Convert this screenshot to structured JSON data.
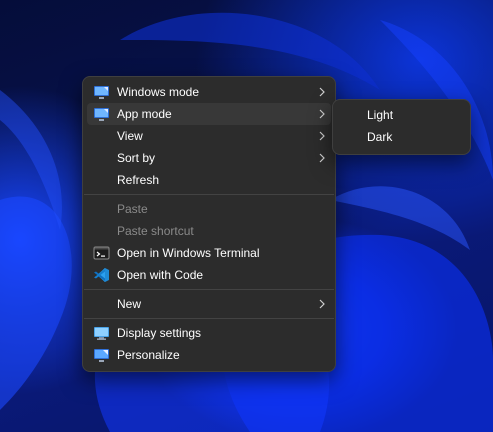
{
  "context_menu": {
    "items": [
      {
        "label": "Windows mode",
        "icon": "monitor-icon",
        "submenu": true
      },
      {
        "label": "App mode",
        "icon": "monitor-icon",
        "submenu": true
      },
      {
        "label": "View",
        "icon": "",
        "submenu": true
      },
      {
        "label": "Sort by",
        "icon": "",
        "submenu": true
      },
      {
        "label": "Refresh",
        "icon": ""
      },
      {
        "label": "Paste",
        "icon": "",
        "disabled": true
      },
      {
        "label": "Paste shortcut",
        "icon": "",
        "disabled": true
      },
      {
        "label": "Open in Windows Terminal",
        "icon": "terminal-icon"
      },
      {
        "label": "Open with Code",
        "icon": "vscode-icon"
      },
      {
        "label": "New",
        "icon": "",
        "submenu": true
      },
      {
        "label": "Display settings",
        "icon": "display-settings-icon"
      },
      {
        "label": "Personalize",
        "icon": "personalize-icon"
      }
    ]
  },
  "app_mode_submenu": {
    "items": [
      {
        "label": "Light"
      },
      {
        "label": "Dark"
      }
    ]
  },
  "colors": {
    "menu_background": "#2c2c2c",
    "hover_background": "#383838",
    "text": "#ffffff",
    "disabled_text": "#8a8a8a",
    "vscode_blue": "#1e8ad6"
  }
}
